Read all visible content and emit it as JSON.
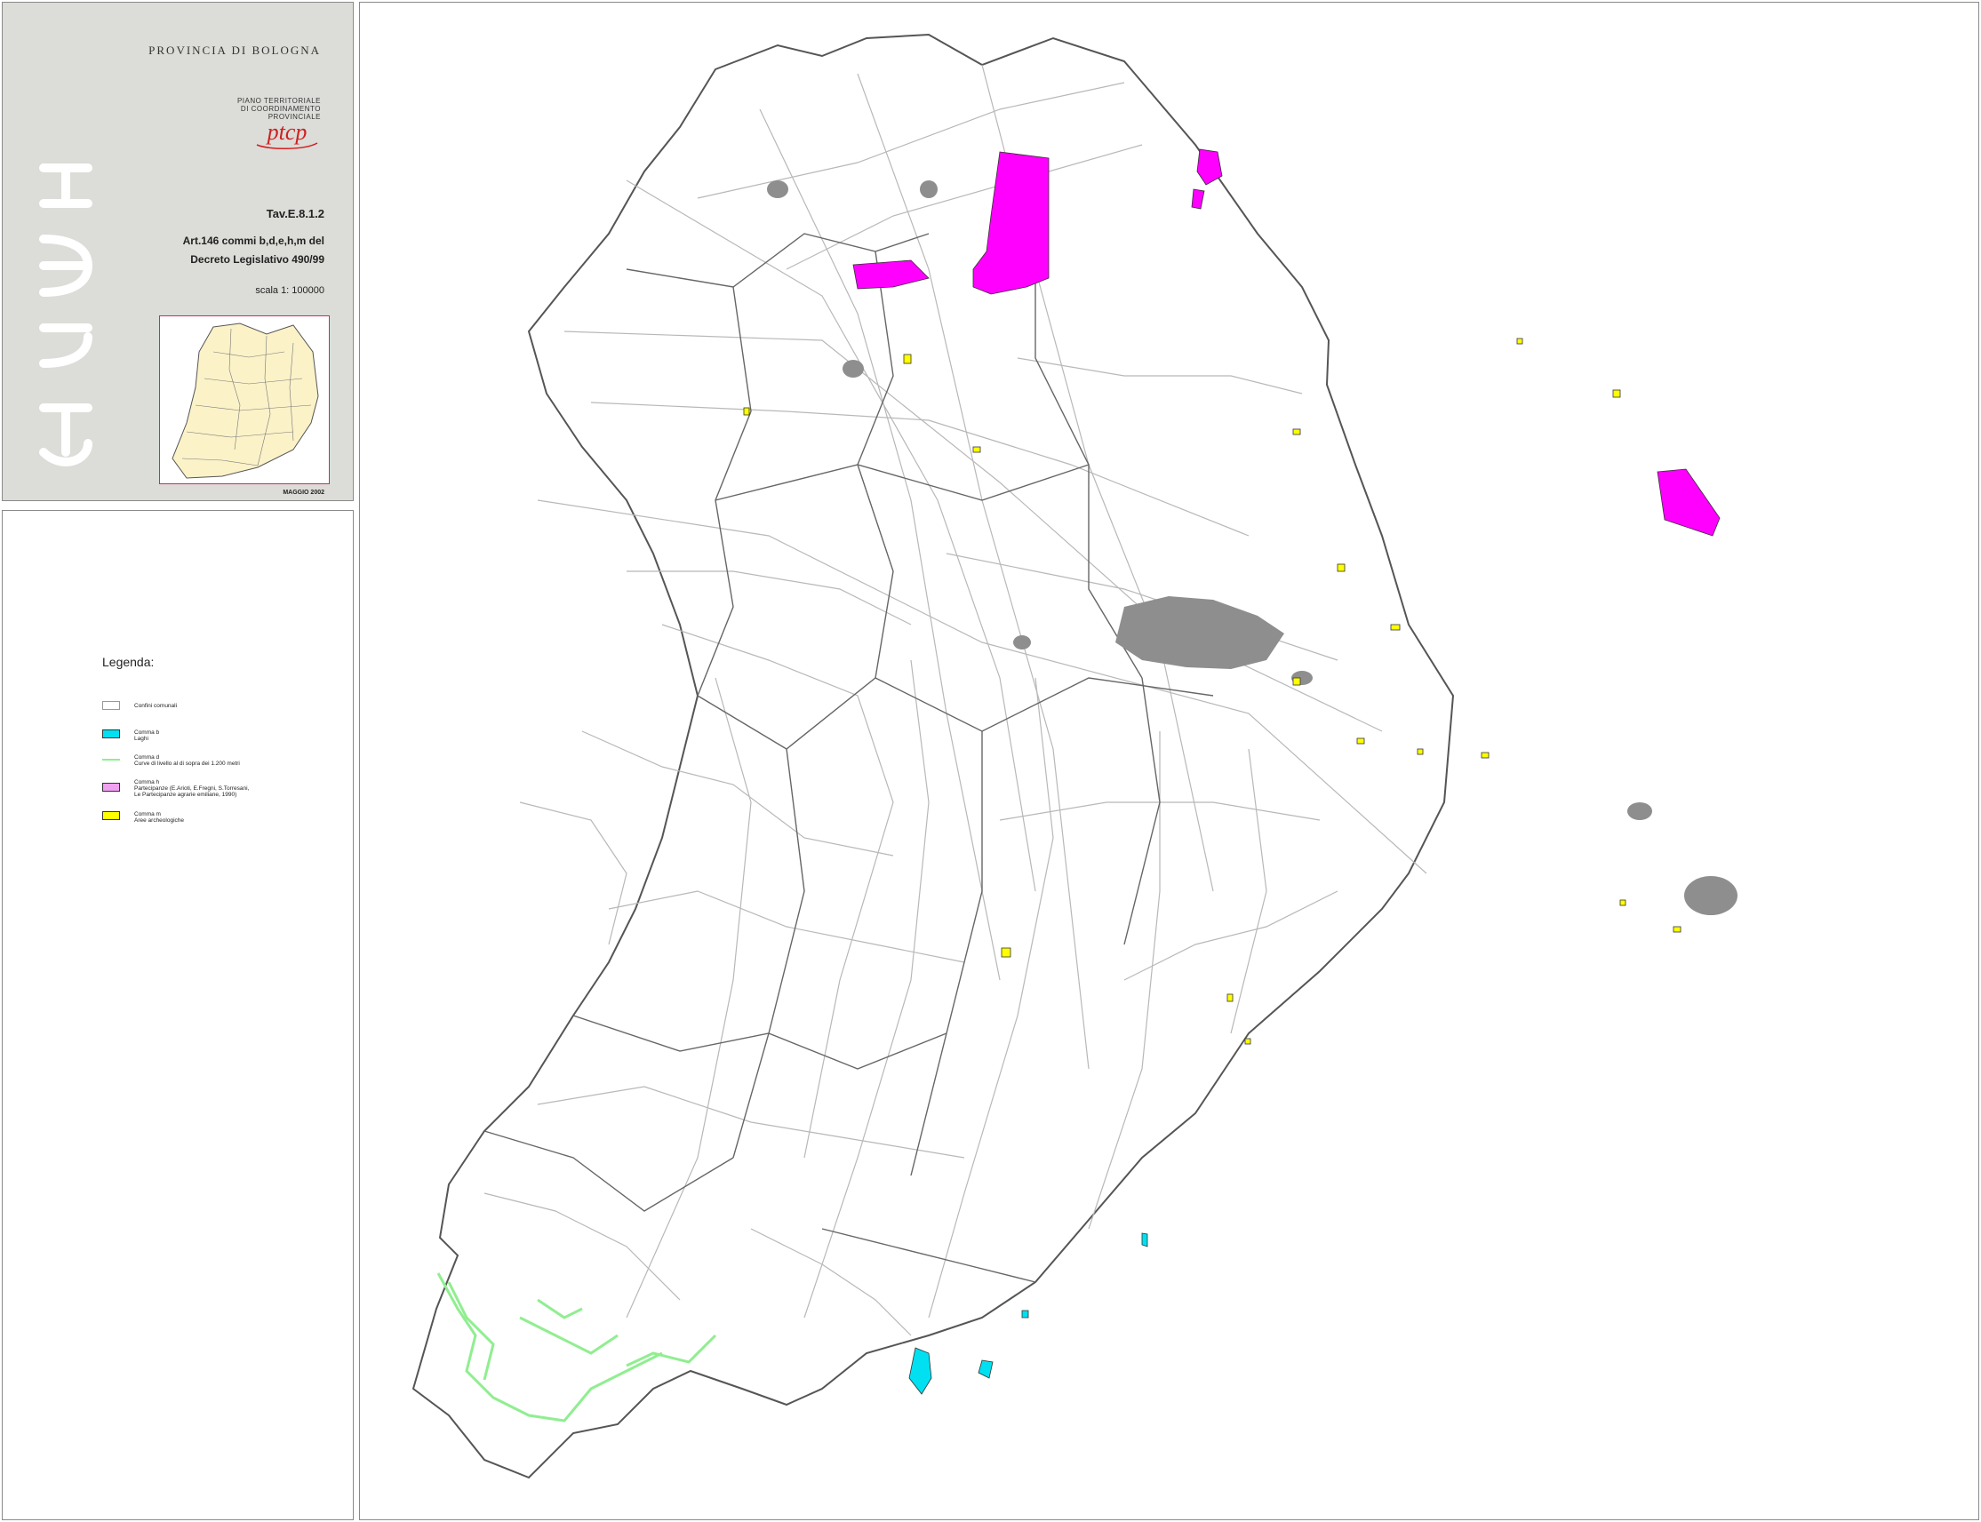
{
  "header": {
    "provincia": "PROVINCIA DI BOLOGNA",
    "ptcp_line1": "PIANO TERRITORIALE",
    "ptcp_line2": "DI COORDINAMENTO",
    "ptcp_line3": "PROVINCIALE",
    "logo_text": "ptcp",
    "tavola": "Tav.E.8.1.2",
    "article_line1": "Art.146 commi b,d,e,h,m del",
    "article_line2": "Decreto Legislativo 490/99",
    "scale": "scala 1: 100000",
    "date": "MAGGIO 2002"
  },
  "legend": {
    "title": "Legenda:",
    "items": [
      {
        "line1": "Confini comunali",
        "line2": "",
        "line3": "",
        "color": "#ffffff",
        "border": "#999999"
      },
      {
        "line1": "Comma b",
        "line2": "Laghi",
        "line3": "",
        "color": "#00e0f0",
        "border": "#333333"
      },
      {
        "line1": "Comma d",
        "line2": "Curve di livello al di sopra dei 1.200 metri",
        "line3": "",
        "color": "#90ee90",
        "border": ""
      },
      {
        "line1": "Comma h",
        "line2": "Partecipanze (E.Arioti, E.Fregni, S.Torresani,",
        "line3": "Le Partecipanze agrarie emiliane, 1990)",
        "color": "#f0a0f0",
        "border": "#333333"
      },
      {
        "line1": "Comma m",
        "line2": "Aree archeologiche",
        "line3": "",
        "color": "#ffff00",
        "border": "#333333"
      }
    ]
  },
  "map": {
    "colors": {
      "roads": "#b8b8b8",
      "boundaries": "#555555",
      "urban": "#8e8e8e",
      "partecipanze": "#ff00ff",
      "laghi": "#00e0f0",
      "curve": "#90ee90",
      "archeologiche": "#ffff00"
    }
  }
}
